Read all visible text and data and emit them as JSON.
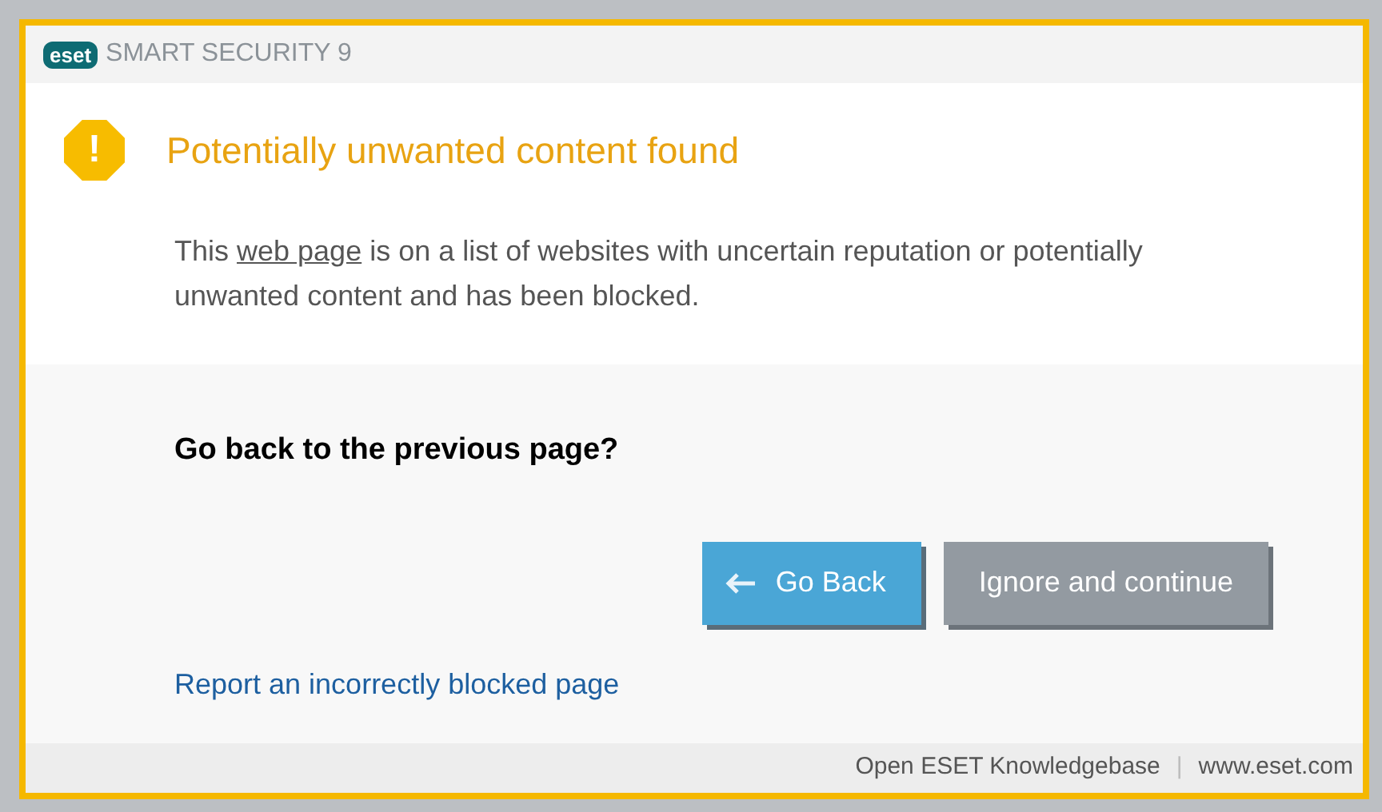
{
  "header": {
    "logo": "eset",
    "product": "SMART SECURITY 9"
  },
  "alert": {
    "title": "Potentially unwanted content found",
    "icon": "!"
  },
  "message": {
    "before": "This ",
    "link": "web page",
    "after": " is on a list of websites with uncertain reputation or potentially unwanted content and has been blocked."
  },
  "question": "Go back to the previous page?",
  "buttons": [
    {
      "label": "Go Back",
      "kind": "primary"
    },
    {
      "label": "Ignore and continue",
      "kind": "secondary"
    }
  ],
  "report_link": "Report an incorrectly blocked page",
  "footer": {
    "links": [
      "Open ESET Knowledgebase",
      "www.eset.com"
    ],
    "separator": "|"
  }
}
